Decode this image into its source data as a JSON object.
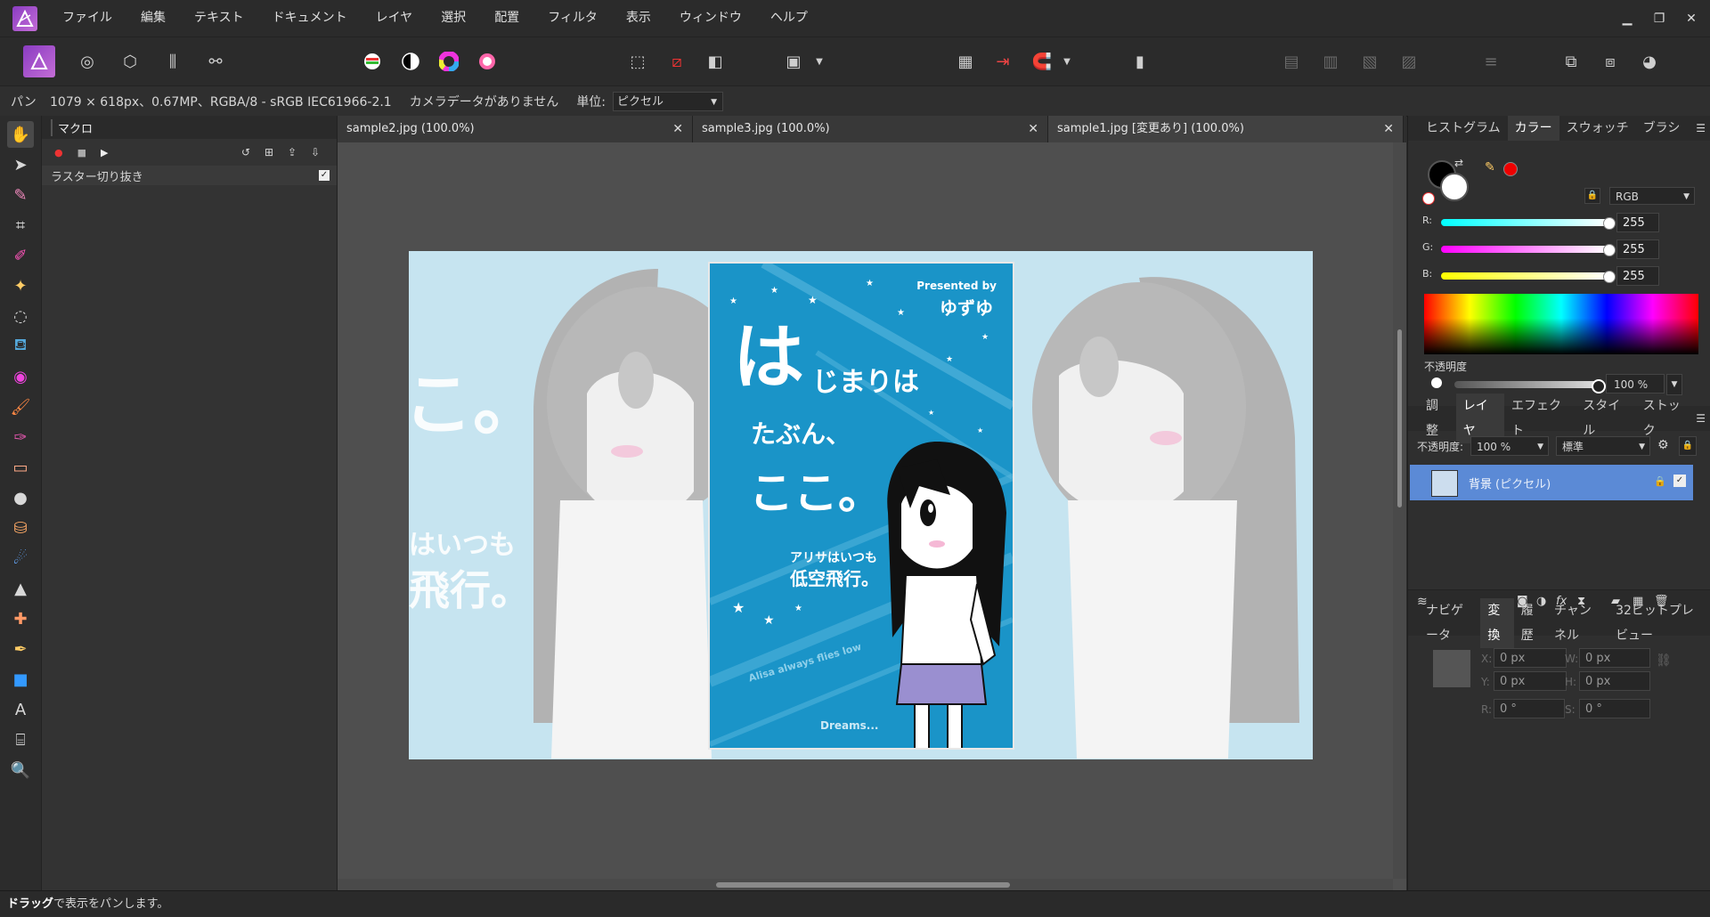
{
  "menu": [
    "ファイル",
    "編集",
    "テキスト",
    "ドキュメント",
    "レイヤ",
    "選択",
    "配置",
    "フィルタ",
    "表示",
    "ウィンドウ",
    "ヘルプ"
  ],
  "context": {
    "tool": "パン",
    "info": "1079 × 618px、0.67MP、RGBA/8 - sRGB IEC61966-2.1",
    "camera": "カメラデータがありません",
    "unit_label": "単位:",
    "unit_value": "ピクセル"
  },
  "macro": {
    "tab": "マクロ",
    "item": "ラスター切り抜き"
  },
  "tabs": [
    {
      "label": "sample2.jpg (100.0%)",
      "close": "✕"
    },
    {
      "label": "sample3.jpg (100.0%)",
      "close": "✕"
    },
    {
      "label": "sample1.jpg [変更あり] (100.0%)",
      "close": "✕"
    }
  ],
  "artwork": {
    "presented": "Presented by",
    "author": "ゆずゆ",
    "line1_big": "は",
    "line1_rest": "じまりは",
    "line2": "たぶん、",
    "line3": "ここ。",
    "sub1": "アリサはいつも",
    "sub2": "低空飛行。",
    "english": "Alisa always flies low",
    "dreams": "Dreams...",
    "bg_left1": "はいつも",
    "bg_left2": "飛行。",
    "bg_left_top": "こ。"
  },
  "color_panel": {
    "tabs": [
      "ヒストグラム",
      "カラー",
      "スウォッチ",
      "ブラシ"
    ],
    "mode": "RGB",
    "r_label": "R:",
    "r": "255",
    "g_label": "G:",
    "g": "255",
    "b_label": "B:",
    "b": "255",
    "opacity_label": "不透明度",
    "opacity": "100 %"
  },
  "layers_panel": {
    "tabs": [
      "調整",
      "レイヤ",
      "エフェクト",
      "スタイル",
      "ストック"
    ],
    "opacity_label": "不透明度:",
    "opacity": "100 %",
    "blend": "標準",
    "layer_name": "背景",
    "layer_type": "(ピクセル)"
  },
  "transform_panel": {
    "tabs": [
      "ナビゲータ",
      "変換",
      "履歴",
      "チャンネル",
      "32ビットプレビュー"
    ],
    "x_label": "X:",
    "x": "0 px",
    "y_label": "Y:",
    "y": "0 px",
    "w_label": "W:",
    "w": "0 px",
    "h_label": "H:",
    "h": "0 px",
    "r_label": "R:",
    "r": "0 °",
    "s_label": "S:",
    "s": "0 °"
  },
  "status": {
    "bold": "ドラッグ",
    "rest": "で表示をパンします。"
  },
  "colors": {
    "accent": "#5b8ad6",
    "poster_bg": "#1a94c8",
    "canvas_bg": "#c6e4f0"
  }
}
